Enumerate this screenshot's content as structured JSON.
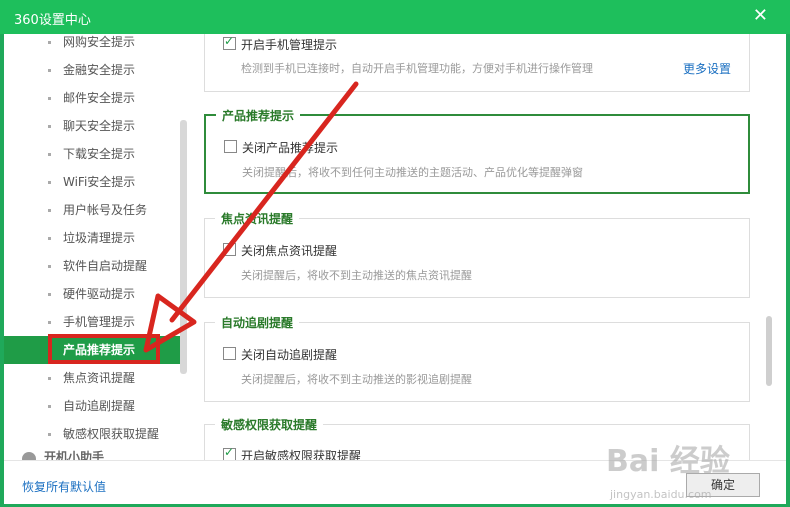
{
  "window": {
    "title": "360设置中心",
    "close": "✕"
  },
  "sidebar": {
    "items": [
      {
        "label": "网购安全提示"
      },
      {
        "label": "金融安全提示"
      },
      {
        "label": "邮件安全提示"
      },
      {
        "label": "聊天安全提示"
      },
      {
        "label": "下载安全提示"
      },
      {
        "label": "WiFi安全提示"
      },
      {
        "label": "用户帐号及任务"
      },
      {
        "label": "垃圾清理提示"
      },
      {
        "label": "软件自启动提醒"
      },
      {
        "label": "硬件驱动提示"
      },
      {
        "label": "手机管理提示"
      },
      {
        "label": "产品推荐提示",
        "active": true
      },
      {
        "label": "焦点资讯提醒"
      },
      {
        "label": "自动追剧提醒"
      },
      {
        "label": "敏感权限获取提醒"
      }
    ],
    "group": "开机小助手"
  },
  "sections": {
    "phone": {
      "option": "开启手机管理提示",
      "desc": "检测到手机已连接时，自动开启手机管理功能，方便对手机进行操作管理",
      "more": "更多设置"
    },
    "recommend": {
      "title": "产品推荐提示",
      "option": "关闭产品推荐提示",
      "desc": "关闭提醒后，将收不到任何主动推送的主题活动、产品优化等提醒弹窗"
    },
    "news": {
      "title": "焦点资讯提醒",
      "option": "关闭焦点资讯提醒",
      "desc": "关闭提醒后，将收不到主动推送的焦点资讯提醒"
    },
    "drama": {
      "title": "自动追剧提醒",
      "option": "关闭自动追剧提醒",
      "desc": "关闭提醒后，将收不到主动推送的影视追剧提醒"
    },
    "perm": {
      "title": "敏感权限获取提醒",
      "option": "开启敏感权限获取提醒"
    }
  },
  "footer": {
    "reset": "恢复所有默认值",
    "ok": "确定"
  },
  "watermark": {
    "brand": "Bai 经验",
    "url": "jingyan.baidu.com"
  },
  "colors": {
    "titlebar": "#1ebf5c",
    "accent": "#1f9c47",
    "highlight": "#d8261f"
  }
}
